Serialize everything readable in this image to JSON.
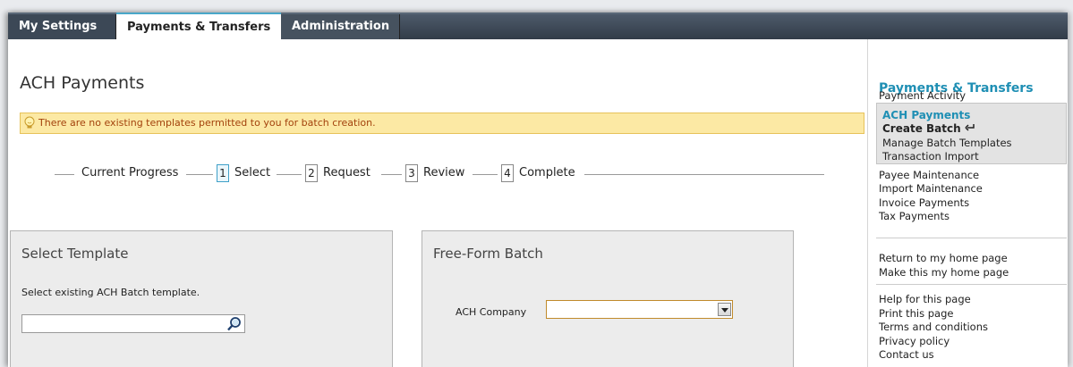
{
  "tabs": [
    "My Settings",
    "Payments & Transfers",
    "Administration"
  ],
  "page_title": "ACH Payments",
  "notice": "There are no existing templates permitted to you for batch creation.",
  "progress": {
    "label": "Current Progress",
    "steps": [
      {
        "num": "1",
        "label": "Select",
        "active": true
      },
      {
        "num": "2",
        "label": "Request",
        "active": false
      },
      {
        "num": "3",
        "label": "Review",
        "active": false
      },
      {
        "num": "4",
        "label": "Complete",
        "active": false
      }
    ]
  },
  "select_template": {
    "title": "Select Template",
    "instruction": "Select existing ACH Batch template.",
    "search_value": ""
  },
  "free_form": {
    "title": "Free-Form Batch",
    "company_label": "ACH Company",
    "company_value": ""
  },
  "sidebar": {
    "heading": "Payments & Transfers",
    "payment_activity": "Payment Activity",
    "ach_heading": "ACH Payments",
    "current": "Create Batch",
    "ach_links": [
      "Manage Batch Templates",
      "Transaction Import"
    ],
    "links": [
      "Payee Maintenance",
      "Import Maintenance",
      "Invoice Payments",
      "Tax Payments"
    ],
    "home_links": [
      "Return to my home page",
      "Make this my home page"
    ],
    "help_links": [
      "Help for this page",
      "Print this page",
      "Terms and conditions",
      "Privacy policy",
      "Contact us"
    ]
  },
  "colors": {
    "accent": "#1f8fb4",
    "notice_bg": "#fce9a4",
    "notice_text": "#a3420c"
  }
}
